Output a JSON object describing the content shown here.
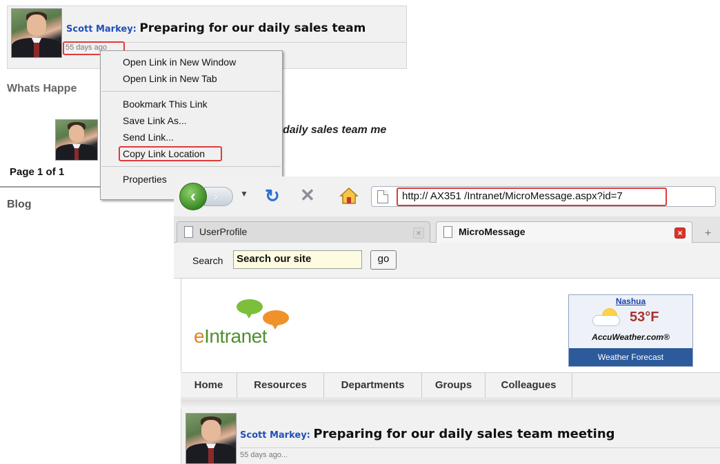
{
  "background_page": {
    "post": {
      "author": "Scott Markey:",
      "text": "Preparing for our daily sales team",
      "time": "55 days ago"
    },
    "section_title": "Whats Happe",
    "feed_text": "daily sales team me",
    "page_count": "Page 1 of 1",
    "blog_title": "Blog"
  },
  "context_menu": {
    "items": [
      {
        "label": "Open Link in New Window"
      },
      {
        "label": "Open Link in New Tab"
      },
      {
        "label": "Bookmark This Link"
      },
      {
        "label": "Save Link As..."
      },
      {
        "label": "Send Link..."
      },
      {
        "label": "Copy Link Location",
        "highlighted": true
      },
      {
        "label": "Properties"
      }
    ]
  },
  "browser": {
    "url": "http:// AX351  /Intranet/MicroMessage.aspx?id=7",
    "tabs": [
      {
        "label": "UserProfile",
        "active": false
      },
      {
        "label": "MicroMessage",
        "active": true
      }
    ],
    "new_tab_symbol": "+",
    "search": {
      "label": "Search",
      "value": "Search our site",
      "button": "go"
    },
    "logo": {
      "first_letter": "e",
      "rest": "Intranet"
    },
    "weather": {
      "city": "Nashua",
      "temperature": "53°F",
      "brand": "AccuWeather.com®",
      "footer": "Weather Forecast"
    },
    "nav": [
      "Home",
      "Resources",
      "Departments",
      "Groups",
      "Colleagues"
    ],
    "post": {
      "author": "Scott Markey:",
      "text": "Preparing for our daily sales team meeting",
      "time": "55 days ago..."
    }
  },
  "icons": {
    "back": "arrow-left-icon",
    "forward": "arrow-right-icon",
    "reload": "reload-icon",
    "stop": "stop-icon",
    "home": "home-icon",
    "page": "page-icon",
    "close": "close-icon"
  },
  "colors": {
    "highlight": "#e03a3a",
    "author": "#1f4fb8",
    "logo_green": "#4f8f2f",
    "weather_footer": "#2c5a9a"
  }
}
